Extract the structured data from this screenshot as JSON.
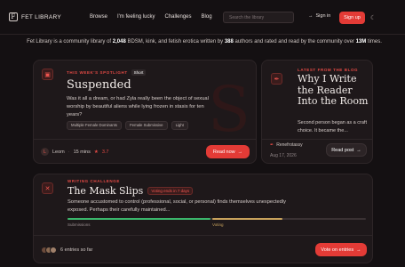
{
  "header": {
    "logo_text": "FET LIBRARY",
    "logo_glyph": "F",
    "nav": [
      "Browse",
      "I'm feeling lucky",
      "Challenges",
      "Blog"
    ],
    "search_placeholder": "Search the library",
    "signin_label": "Sign in",
    "signup_label": "Sign up",
    "theme_icon": "moon-icon"
  },
  "intro": {
    "part1": "Fet Library is a community library of ",
    "count_works": "2,048",
    "part2": " BDSM, kink, and fetish erotica written by ",
    "count_authors": "388",
    "part3": " authors and rated and read by the community over ",
    "count_times": "13M",
    "part4": " times."
  },
  "spotlight": {
    "label": "THIS WEEK'S SPOTLIGHT",
    "badge": "Short",
    "title": "Suspended",
    "summary": "Was it all a dream, or had Zyla really been the object of sexual worship by beautiful aliens while lying frozen in stasis for ten years?",
    "chips": [
      "Multiple Female Dominants",
      "Female Submissive",
      "Light"
    ],
    "author": "Leom",
    "author_initial": "L",
    "read_time": "15 mins",
    "rating": "3.7",
    "button": "Read now",
    "watermark": "S",
    "icon": "book-icon"
  },
  "blog": {
    "label": "LATEST FROM THE BLOG",
    "title": "Why I Write the Reader Into the Room",
    "summary": "Second person began as a craft choice. It became the...",
    "author": "Renefrotassy",
    "date": "Aug 17, 2026",
    "button": "Read post",
    "icon": "pen-icon"
  },
  "challenge": {
    "label": "WRITING CHALLENGE",
    "badge": "Voting ends in 7 days",
    "title": "The Mask Slips",
    "summary": "Someone accustomed to control (professional, social, or personal) finds themselves unexpectedly exposed. Perhaps their carefully maintained...",
    "phase1": "Submissions",
    "phase2": "Voting",
    "progress_fraction": 0.72,
    "entries": "6 entries so far",
    "button": "Vote on entries",
    "icon": "close-icon"
  },
  "colors": {
    "accent": "#e33b36",
    "background": "#141012",
    "card": "#1e181a",
    "progress_voting": "#c8a25c",
    "progress_submissions": "#3bb56b"
  }
}
